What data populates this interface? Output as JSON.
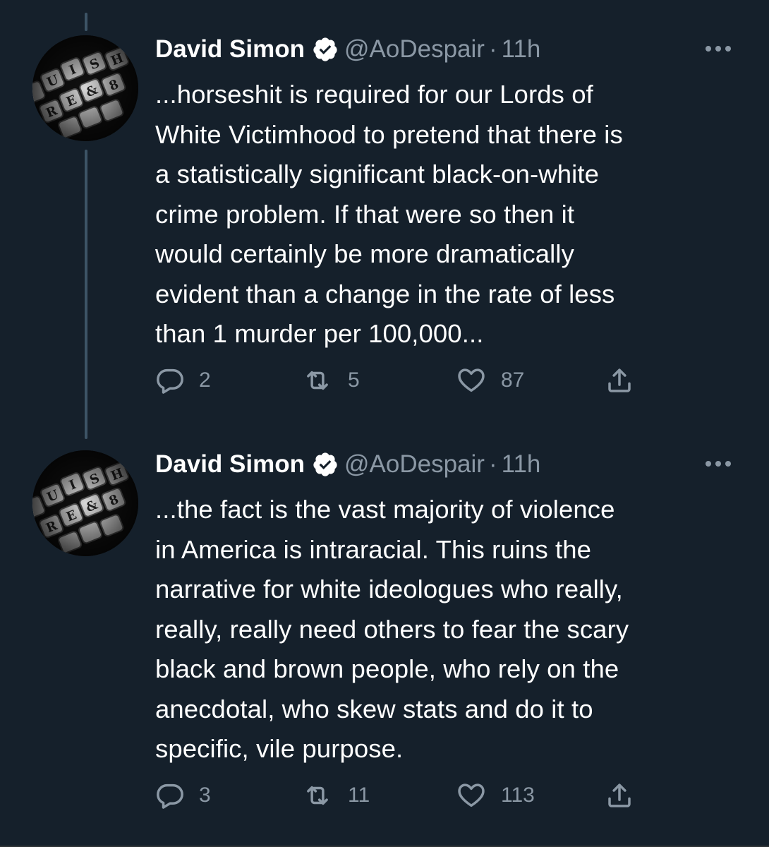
{
  "theme": {
    "background": "#15202b",
    "text": "#ffffff",
    "muted": "#8b98a5",
    "thread_line": "#3d5466"
  },
  "tweets": [
    {
      "display_name": "David Simon",
      "verified": true,
      "handle": "@AoDespair",
      "separator": "·",
      "time": "11h",
      "text": "...horseshit is required for our Lords of\nWhite Victimhood to pretend that there is\na statistically significant black-on-white\ncrime problem. If that were so then it\nwould certainly be more dramatically\nevident than a change in the rate of less\nthan 1 murder per 100,000...",
      "replies": "2",
      "retweets": "5",
      "likes": "87"
    },
    {
      "display_name": "David Simon",
      "verified": true,
      "handle": "@AoDespair",
      "separator": "·",
      "time": "11h",
      "text": "...the fact is the vast majority of violence\nin America is intraracial. This ruins the\nnarrative for white ideologues who really,\nreally, really need others to fear the scary\nblack and brown people, who rely on the\nanecdotal, who skew stats and do it to\nspecific, vile purpose.",
      "replies": "3",
      "retweets": "11",
      "likes": "113"
    }
  ],
  "icons": {
    "verified": "verified-badge-icon",
    "more": "more-options-icon",
    "reply": "reply-icon",
    "retweet": "retweet-icon",
    "like": "like-icon",
    "share": "share-icon"
  }
}
